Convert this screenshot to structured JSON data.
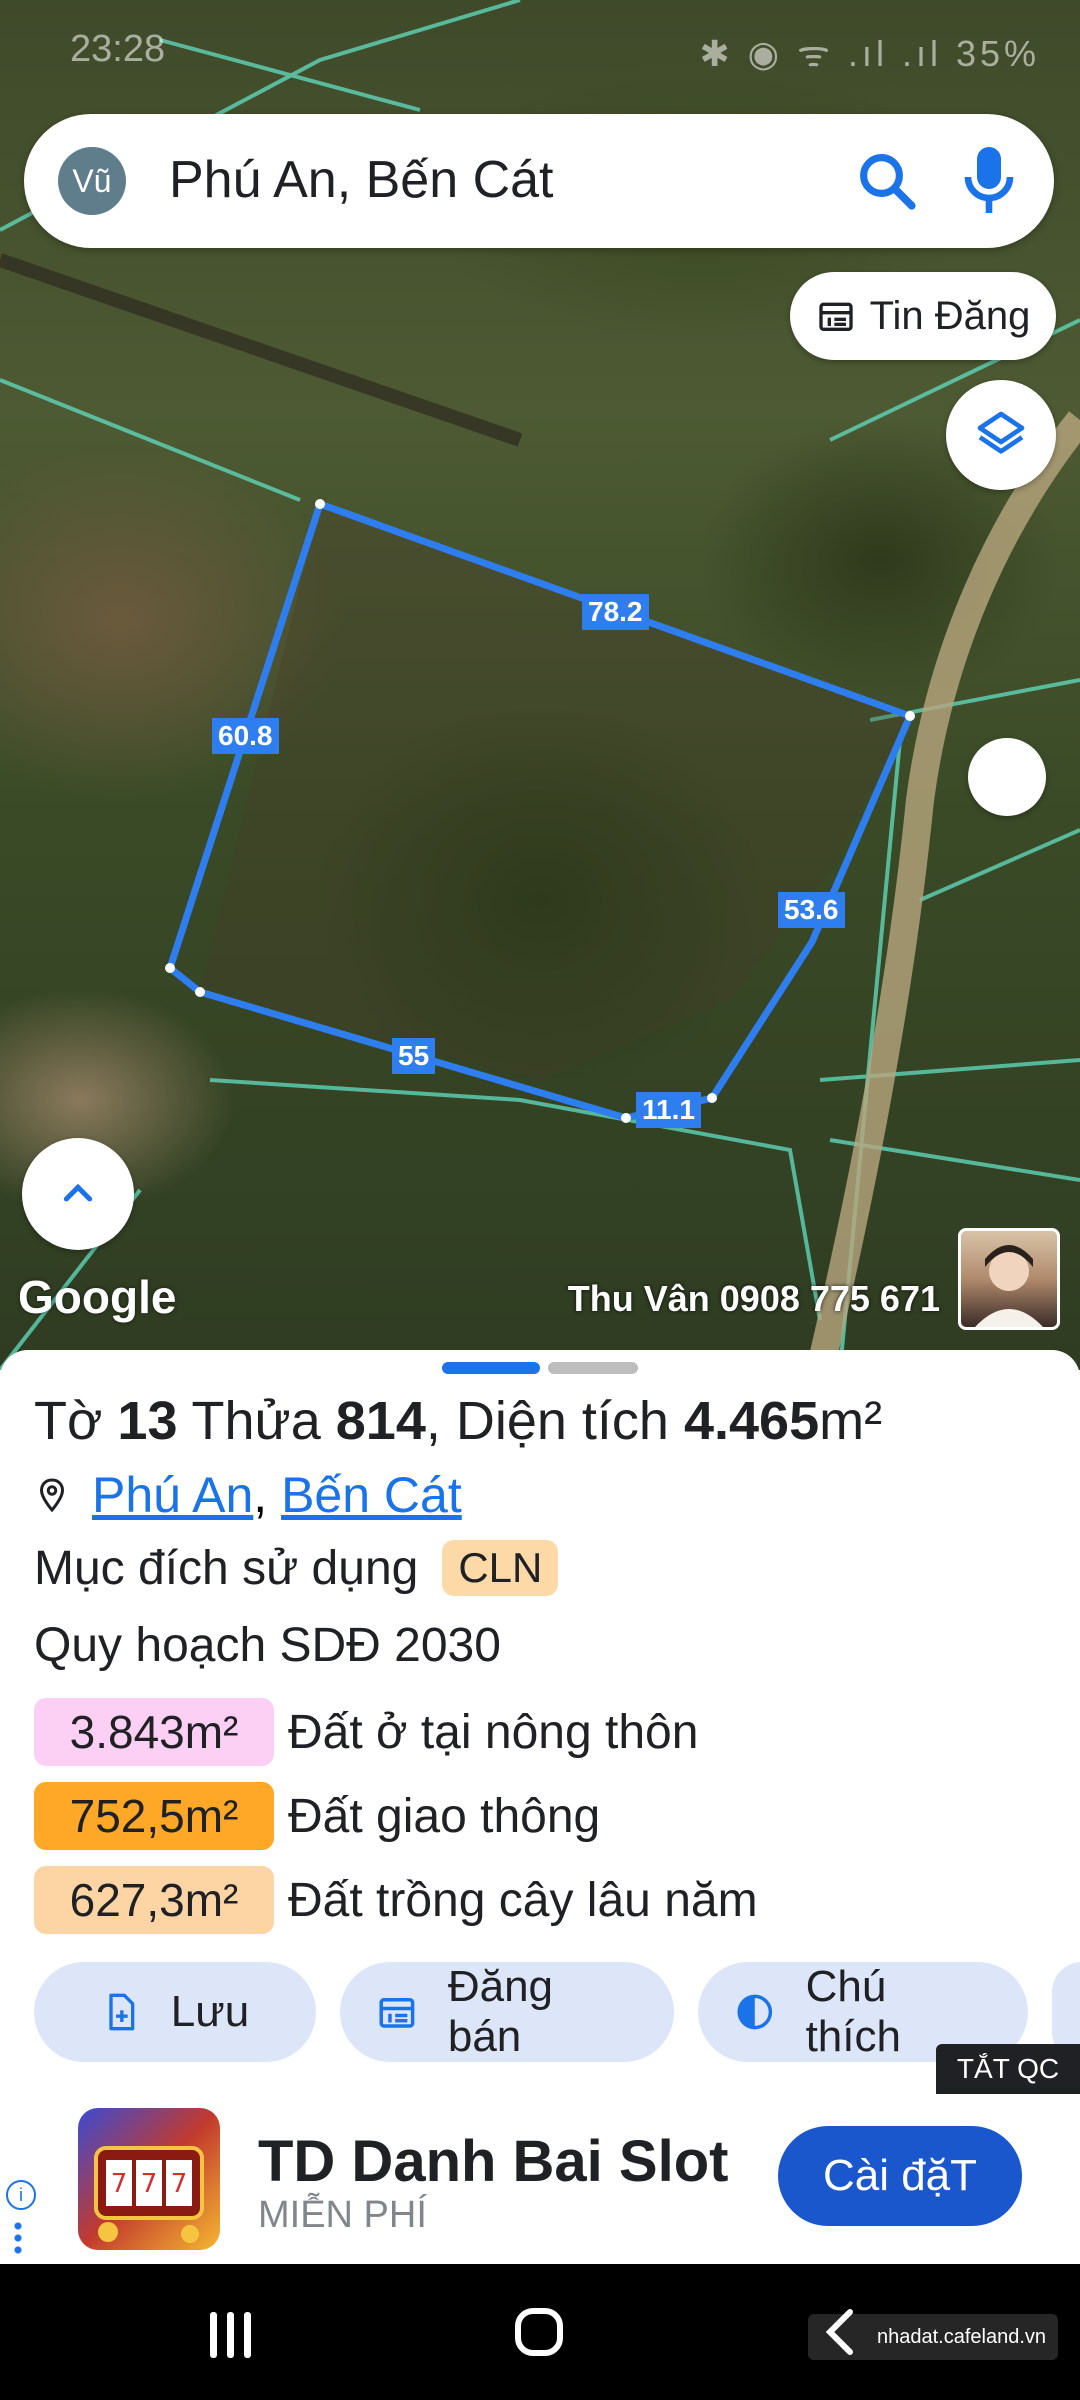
{
  "status_bar": {
    "time": "23:28",
    "icons_text": "✱ ◉ ᯤ .ıl .ıl 35%"
  },
  "search": {
    "avatar_initials": "Vũ",
    "query": "Phú An, Bến Cát"
  },
  "chips": {
    "tin_dang": "Tin Đăng"
  },
  "parcel_edges": {
    "top": "78.2",
    "left": "60.8",
    "right": "53.6",
    "bottom_left": "55",
    "bottom_right": "11.1"
  },
  "map": {
    "google": "Google",
    "watermark": "Thu Vân 0908 775 671"
  },
  "parcel": {
    "to_label": "Tờ",
    "to_value": "13",
    "thua_label": "Thửa",
    "thua_value": "814",
    "area_label": ", Diện tích",
    "area_value": "4.465",
    "area_unit": "m²",
    "location_1": "Phú An",
    "location_sep": ",",
    "location_2": "Bến Cát",
    "purpose_label": "Mục đích sử dụng",
    "purpose_code": "CLN",
    "plan_label": "Quy hoạch SDĐ 2030",
    "zones": [
      {
        "area": "3.843m²",
        "label": "Đất ở tại nông thôn",
        "color": "#fcd0f5"
      },
      {
        "area": "752,5m²",
        "label": "Đất giao thông",
        "color": "#ffa726"
      },
      {
        "area": "627,3m²",
        "label": "Đất trồng cây lâu năm",
        "color": "#fdd5a4"
      }
    ]
  },
  "actions": {
    "save": "Lưu",
    "sell": "Đăng bán",
    "legend": "Chú thích"
  },
  "ad": {
    "close_label": "TẮT QC",
    "title": "TD Danh Bai Slot",
    "subtitle": "MIỄN PHÍ",
    "cta": "Cài đặT",
    "info": "i"
  },
  "navbar": {
    "watermark": "nhadat.cafeland.vn"
  },
  "colors": {
    "accent": "#1a73e8",
    "parcel_line": "#2f7ef0",
    "cadastral_line": "#5fd6b8"
  }
}
